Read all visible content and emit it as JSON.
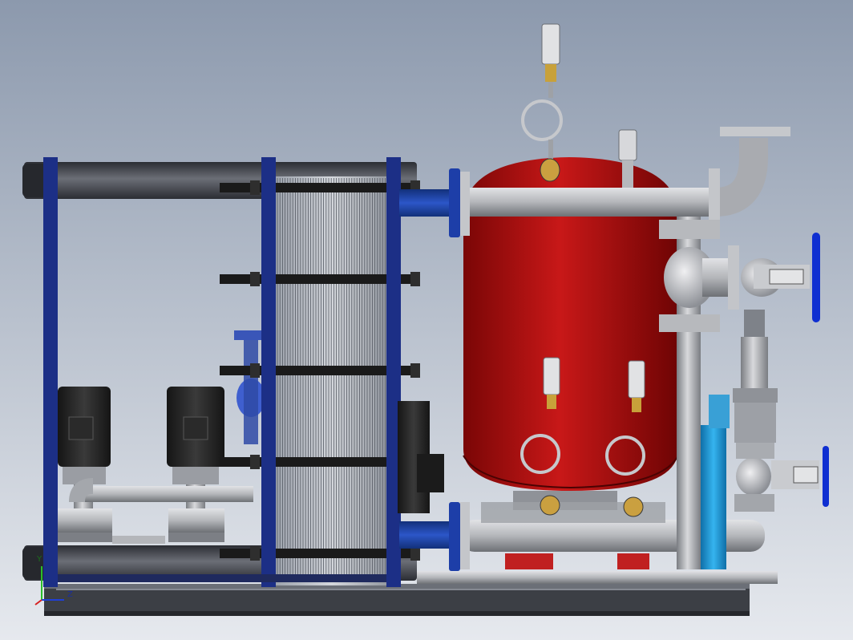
{
  "viewport": {
    "background_top": "#8c99ad",
    "background_bottom": "#e6e9ee"
  },
  "colors": {
    "tank_red": "#b81010",
    "frame_blue": "#1c2f86",
    "pipe_blue": "#1f45b8",
    "pipe_gray": "#b4b6ba",
    "dark_pipe": "#4a4d55",
    "handwheel_blue": "#0f2fd1",
    "cyan_pump": "#2aa3e0",
    "base_gray": "#3c3f45"
  },
  "assembly": {
    "components": [
      "plate-heat-exchanger",
      "pressurized-expansion-tank",
      "vertical-circulation-pump",
      "vertical-circulation-pump",
      "gate-valve",
      "gate-valve",
      "safety-valve",
      "pressure-gauge",
      "pressure-gauge",
      "pressure-gauge",
      "base-frame"
    ]
  },
  "triad": {
    "y_label": "Y",
    "z_label": "Z"
  }
}
